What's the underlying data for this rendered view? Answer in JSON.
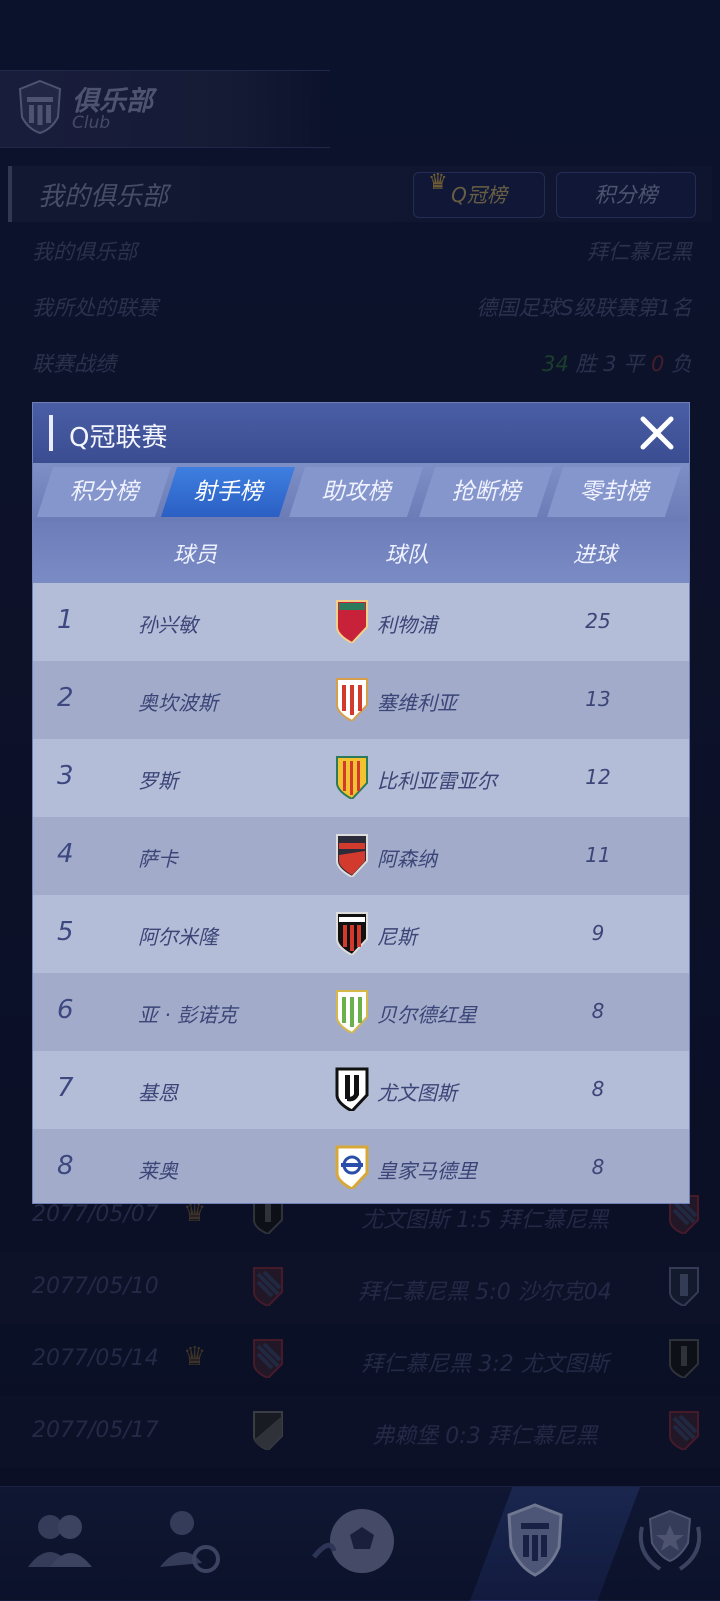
{
  "club_header": {
    "title": "俱乐部",
    "subtitle": "Club"
  },
  "my_club": {
    "section_title": "我的俱乐部",
    "q_tab_label": "Q冠榜",
    "points_tab_label": "积分榜",
    "rows": [
      {
        "label": "我的俱乐部",
        "value": "拜仁慕尼黑"
      },
      {
        "label": "我所处的联赛",
        "value": "德国足球S级联赛第1名"
      }
    ],
    "record": {
      "label": "联赛战绩",
      "wins": "34",
      "win_text": "胜",
      "draws": "3",
      "draw_text": "平",
      "losses": "0",
      "loss_text": "负"
    }
  },
  "matches": [
    {
      "date": "2077/05/07",
      "crown": true,
      "home": "尤文图斯",
      "score": "1:5",
      "away": "拜仁慕尼黑"
    },
    {
      "date": "2077/05/10",
      "crown": false,
      "home": "拜仁慕尼黑",
      "score": "5:0",
      "away": "沙尔克04"
    },
    {
      "date": "2077/05/14",
      "crown": true,
      "home": "拜仁慕尼黑",
      "score": "3:2",
      "away": "尤文图斯"
    },
    {
      "date": "2077/05/17",
      "crown": false,
      "home": "弗赖堡",
      "score": "0:3",
      "away": "拜仁慕尼黑"
    }
  ],
  "modal": {
    "title": "Q冠联赛",
    "tabs": [
      "积分榜",
      "射手榜",
      "助攻榜",
      "抢断榜",
      "零封榜"
    ],
    "active_tab": "射手榜",
    "columns": {
      "player": "球员",
      "team": "球队",
      "goals": "进球"
    },
    "rows": [
      {
        "rank": "1",
        "player": "孙兴敏",
        "team": "利物浦",
        "goals": "25",
        "crest": "red-shield"
      },
      {
        "rank": "2",
        "player": "奥坎波斯",
        "team": "塞维利亚",
        "goals": "13",
        "crest": "red-white-stripes"
      },
      {
        "rank": "3",
        "player": "罗斯",
        "team": "比利亚雷亚尔",
        "goals": "12",
        "crest": "yellow-red-stripes"
      },
      {
        "rank": "4",
        "player": "萨卡",
        "team": "阿森纳",
        "goals": "11",
        "crest": "red-white-diagonal"
      },
      {
        "rank": "5",
        "player": "阿尔米隆",
        "team": "尼斯",
        "goals": "9",
        "crest": "red-black-stripes"
      },
      {
        "rank": "6",
        "player": "亚 · 彭诺克",
        "team": "贝尔德红星",
        "goals": "8",
        "crest": "green-white-stripes"
      },
      {
        "rank": "7",
        "player": "基恩",
        "team": "尤文图斯",
        "goals": "8",
        "crest": "black-white-j"
      },
      {
        "rank": "8",
        "player": "莱奥",
        "team": "皇家马德里",
        "goals": "8",
        "crest": "white-gold"
      }
    ]
  },
  "colors": {
    "accent": "#2b5fc4",
    "modal_bg": "#a9b3d0",
    "header": "#3b4d91"
  }
}
